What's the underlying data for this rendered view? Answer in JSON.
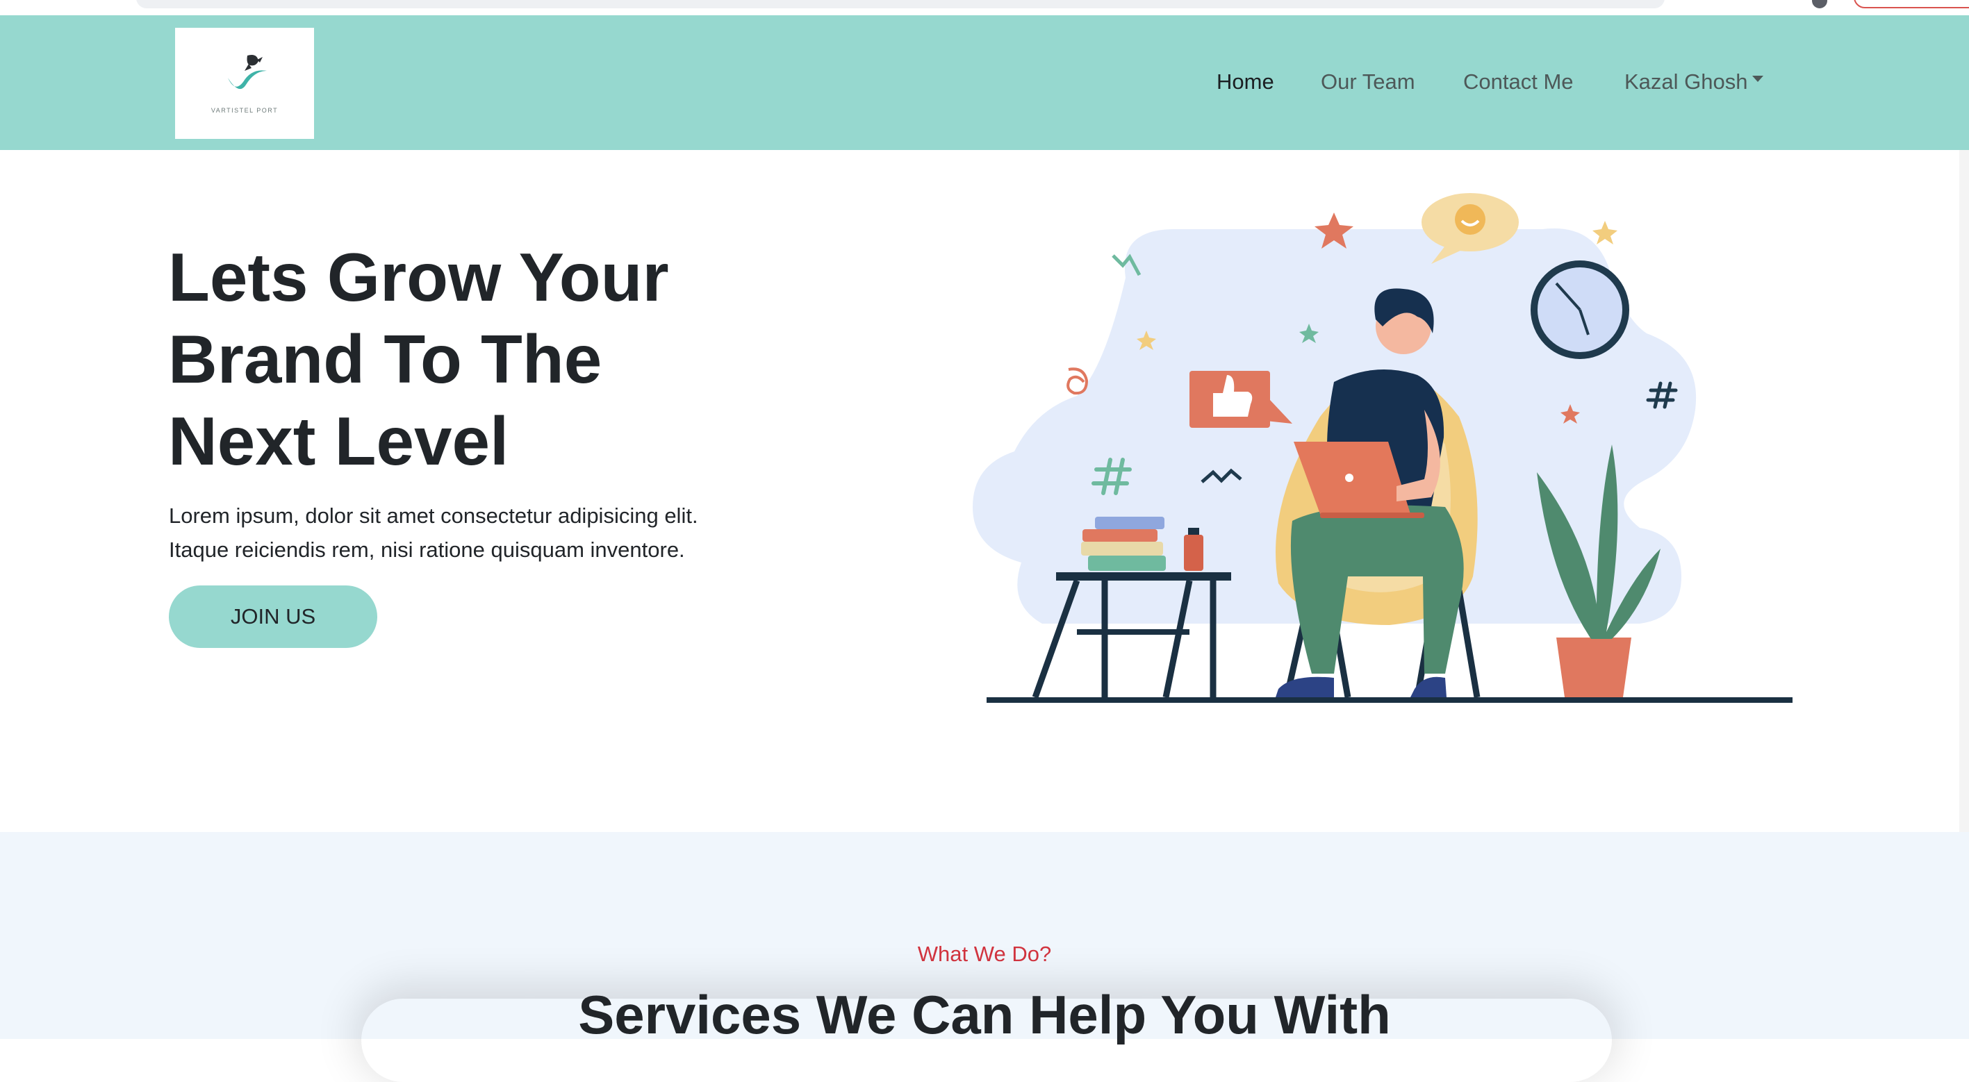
{
  "brand": {
    "logo_text": "VARTISTEL PORT",
    "color_primary": "#96d8cf",
    "color_accent": "#d2343f",
    "color_section_bg": "#f0f6fc"
  },
  "nav": {
    "items": [
      {
        "label": "Home",
        "active": true
      },
      {
        "label": "Our Team",
        "active": false
      },
      {
        "label": "Contact Me",
        "active": false
      },
      {
        "label": "Kazal Ghosh",
        "active": false,
        "dropdown": true
      }
    ]
  },
  "hero": {
    "title_line1": "Lets Grow Your",
    "title_line2": "Brand To The",
    "title_line3": "Next Level",
    "description_line1": "Lorem ipsum, dolor sit amet consectetur adipisicing elit.",
    "description_line2": "Itaque reiciendis rem, nisi ratione quisquam inventore.",
    "cta_label": "JOIN US",
    "illustration_icon": "person-with-laptop-illustration"
  },
  "services": {
    "kicker": "What We Do?",
    "title": "Services We Can Help You With"
  }
}
